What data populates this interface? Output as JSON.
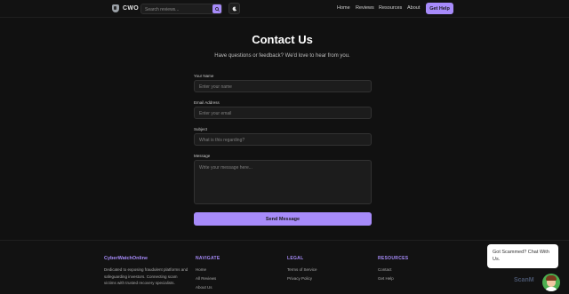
{
  "header": {
    "logo_text": "CWO",
    "search_placeholder": "Search reviews...",
    "nav": [
      "Home",
      "Reviews",
      "Resources",
      "About"
    ],
    "cta": "Get Help"
  },
  "main": {
    "title": "Contact Us",
    "subtitle": "Have questions or feedback? We'd love to hear from you.",
    "fields": {
      "name_label": "Your Name",
      "name_placeholder": "Enter your name",
      "email_label": "Email Address",
      "email_placeholder": "Enter your email",
      "subject_label": "Subject",
      "subject_placeholder": "What is this regarding?",
      "message_label": "Message",
      "message_placeholder": "Write your message here..."
    },
    "submit": "Send Message"
  },
  "footer": {
    "brand": "CyberWatchOnline",
    "description": "Dedicated to exposing fraudulent platforms and safeguarding investors. Connecting scam victims with trusted recovery specialists.",
    "navigate": {
      "heading": "NAVIGATE",
      "links": [
        "Home",
        "All Reviews",
        "About Us"
      ]
    },
    "legal": {
      "heading": "LEGAL",
      "links": [
        "Terms of Service",
        "Privacy Policy"
      ]
    },
    "resources": {
      "heading": "RESOURCES",
      "links": [
        "Contact",
        "Get Help"
      ]
    }
  },
  "chat": {
    "message": "Got Scammed? Chat With Us.",
    "watermark": "ScanM"
  },
  "colors": {
    "accent": "#a78bfa",
    "background": "#111111"
  }
}
